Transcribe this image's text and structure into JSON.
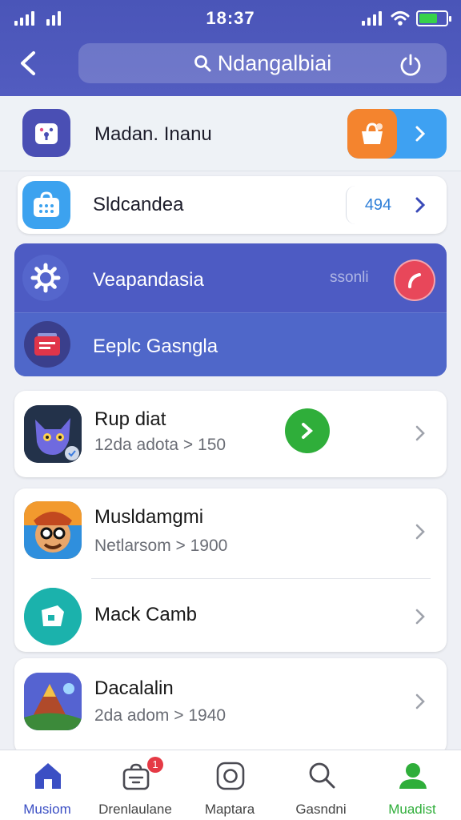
{
  "status_bar": {
    "time": "18:37",
    "battery_color": "#37d24a"
  },
  "header": {
    "search_text": "Ndangalbiai",
    "icons": [
      "back-arrow-icon",
      "search-icon",
      "power-icon"
    ]
  },
  "rows": {
    "row1": {
      "label": "Madan. Inanu",
      "icon": "lock-app-icon",
      "action_icons": [
        "bag-icon",
        "chevron-right-icon"
      ]
    },
    "row2": {
      "label": "Sldcandea",
      "count": "494",
      "icon": "briefcase-icon"
    },
    "row3": {
      "label": "Veapandasia",
      "side_text": "ssonli",
      "icon": "gear-icon"
    },
    "row4": {
      "label": "Eeplc Gasngla",
      "icon": "card-icon"
    }
  },
  "apps": [
    {
      "title": "Rup diat",
      "subtitle": "12da adota > 150",
      "icon": "cat-avatar-icon"
    },
    {
      "title": "Musldamgmi",
      "subtitle": "Netlarsom > 1900",
      "icon": "character-avatar-icon"
    },
    {
      "title": "Mack Camb",
      "subtitle": "",
      "icon": "teal-app-icon"
    },
    {
      "title": "Dacalalin",
      "subtitle": "2da adom > 1940",
      "icon": "mountain-app-icon"
    }
  ],
  "bottom_nav": [
    {
      "label": "Musiom",
      "icon": "home-icon",
      "active": true,
      "color": "#3b4fc4"
    },
    {
      "label": "Drenlaulane",
      "icon": "bag-icon",
      "badge": "1"
    },
    {
      "label": "Maptara",
      "icon": "instagram-icon"
    },
    {
      "label": "Gasndni",
      "icon": "search-icon"
    },
    {
      "label": "Muadist",
      "icon": "profile-icon",
      "color": "#2fae3a"
    }
  ]
}
